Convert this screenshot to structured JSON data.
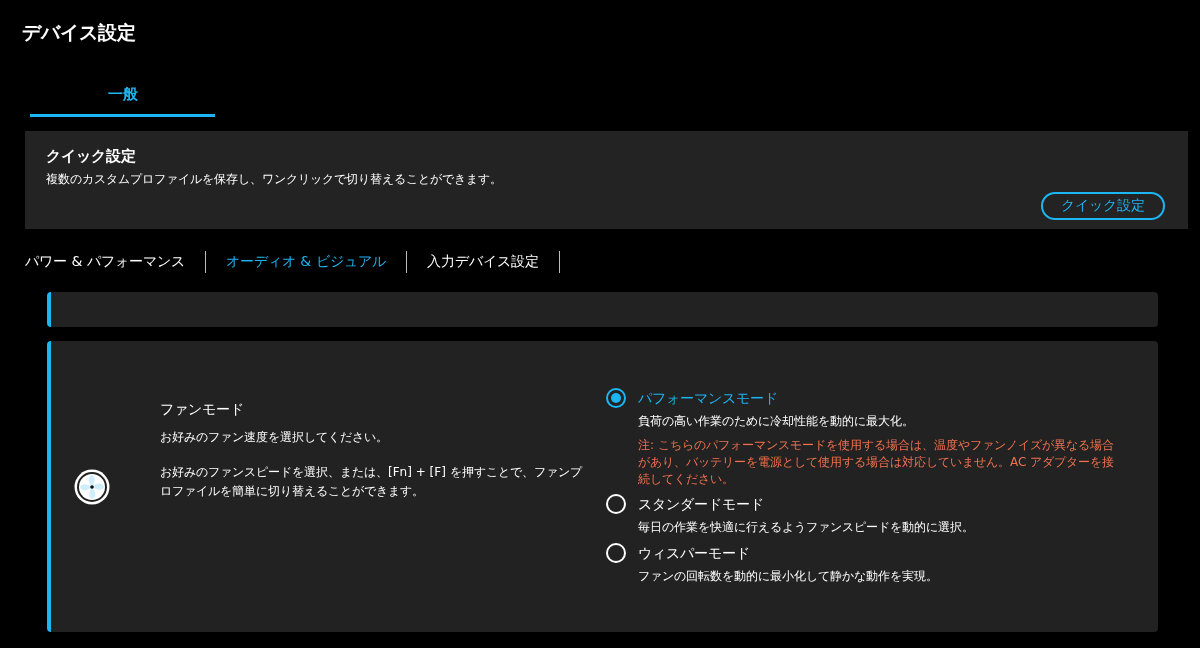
{
  "window": {
    "title": "デバイス設定"
  },
  "tabs": [
    {
      "label": "一般",
      "selected": true
    }
  ],
  "quick_settings": {
    "title": "クイック設定",
    "description": "複数のカスタムプロファイルを保存し、ワンクリックで切り替えることができます。",
    "button": "クイック設定"
  },
  "sub_tabs": [
    {
      "label": "パワー & パフォーマンス",
      "selected": false
    },
    {
      "label": "オーディオ & ビジュアル",
      "selected": true
    },
    {
      "label": "入力デバイス設定",
      "selected": false
    }
  ],
  "fan_mode": {
    "title": "ファンモード",
    "subtitle": "お好みのファン速度を選択してください。",
    "description": "お好みのファンスピードを選択、または、[Fn] + [F] を押すことで、ファンプロファイルを簡単に切り替えることができます。",
    "options": [
      {
        "label": "パフォーマンスモード",
        "description": "負荷の高い作業のために冷却性能を動的に最大化。",
        "note": "注: こちらのパフォーマンスモードを使用する場合は、温度やファンノイズが異なる場合があり、バッテリーを電源として使用する場合は対応していません。AC アダプターを接続してください。",
        "selected": true
      },
      {
        "label": "スタンダードモード",
        "description": "毎日の作業を快適に行えるようファンスピードを動的に選択。",
        "selected": false
      },
      {
        "label": "ウィスパーモード",
        "description": "ファンの回転数を動的に最小化して静かな動作を実現。",
        "selected": false
      }
    ]
  }
}
